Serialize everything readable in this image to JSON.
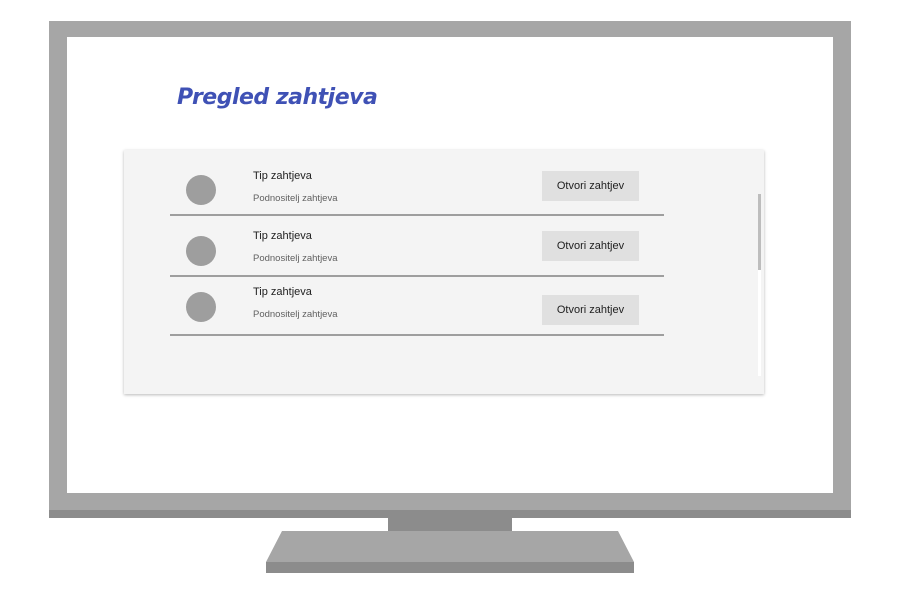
{
  "page": {
    "title": "Pregled zahtjeva"
  },
  "requests": [
    {
      "type": "Tip zahtjeva",
      "submitter": "Podnositelj zahtjeva",
      "button_label": "Otvori zahtjev"
    },
    {
      "type": "Tip zahtjeva",
      "submitter": "Podnositelj zahtjeva",
      "button_label": "Otvori zahtjev"
    },
    {
      "type": "Tip zahtjeva",
      "submitter": "Podnositelj zahtjeva",
      "button_label": "Otvori zahtjev"
    }
  ],
  "colors": {
    "title": "#3f51b5",
    "panel": "#f4f4f4",
    "button": "#e0e0e0",
    "avatar": "#9e9e9e",
    "frame": "#a6a6a6"
  },
  "icons": {
    "avatar": "avatar-placeholder-icon"
  }
}
